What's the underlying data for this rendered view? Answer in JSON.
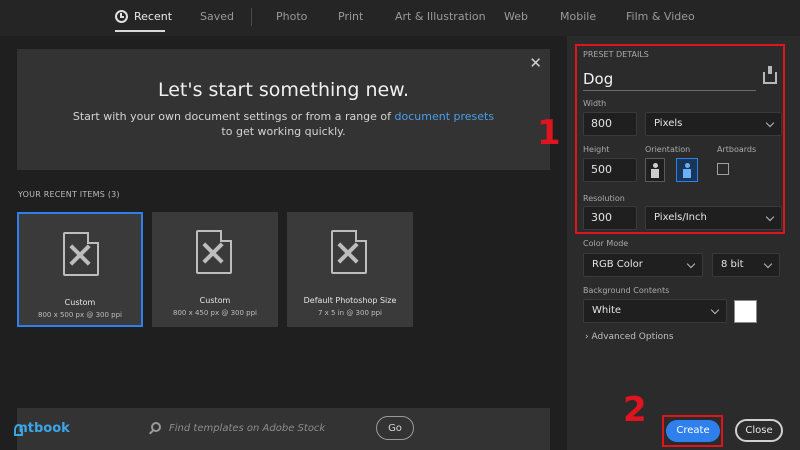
{
  "nav": {
    "tabs": [
      {
        "label": "Recent",
        "icon": "clock-icon",
        "active": true
      },
      {
        "label": "Saved"
      },
      {
        "label": "Photo"
      },
      {
        "label": "Print"
      },
      {
        "label": "Art & Illustration"
      },
      {
        "label": "Web"
      },
      {
        "label": "Mobile"
      },
      {
        "label": "Film & Video"
      }
    ]
  },
  "hero": {
    "title": "Let's start something new.",
    "text_before": "Start with your own document settings or from a range of",
    "link": "document presets",
    "text_after": "to get working quickly.",
    "close": "✕"
  },
  "recent": {
    "header": "YOUR RECENT ITEMS",
    "count": "(3)",
    "items": [
      {
        "name": "Custom",
        "meta": "800 x 500 px @ 300 ppi",
        "selected": true
      },
      {
        "name": "Custom",
        "meta": "800 x 450 px @ 300 ppi"
      },
      {
        "name": "Default Photoshop Size",
        "meta": "7 x 5 in @ 300 ppi"
      }
    ]
  },
  "search": {
    "placeholder": "Find templates on Adobe Stock",
    "go_label": "Go"
  },
  "brand": {
    "name": "ntbook",
    "color": "#3aa6e8"
  },
  "preset": {
    "section_label": "PRESET DETAILS",
    "name": "Dog",
    "width_label": "Width",
    "width_value": "800",
    "width_unit": "Pixels",
    "height_label": "Height",
    "height_value": "500",
    "orientation_label": "Orientation",
    "artboards_label": "Artboards",
    "resolution_label": "Resolution",
    "resolution_value": "300",
    "resolution_unit": "Pixels/Inch",
    "color_mode_label": "Color Mode",
    "color_mode": "RGB Color",
    "bit_depth": "8 bit",
    "background_label": "Background Contents",
    "background": "White",
    "background_swatch": "#ffffff",
    "advanced_label": "Advanced Options"
  },
  "actions": {
    "create_label": "Create",
    "close_label": "Close"
  },
  "annotations": {
    "step1": "1",
    "step2": "2",
    "color": "#e0141e"
  },
  "colors": {
    "accent": "#2f80ed",
    "link": "#4a9eea",
    "background": "#1f1f1f",
    "panel": "#2b2b2b"
  }
}
